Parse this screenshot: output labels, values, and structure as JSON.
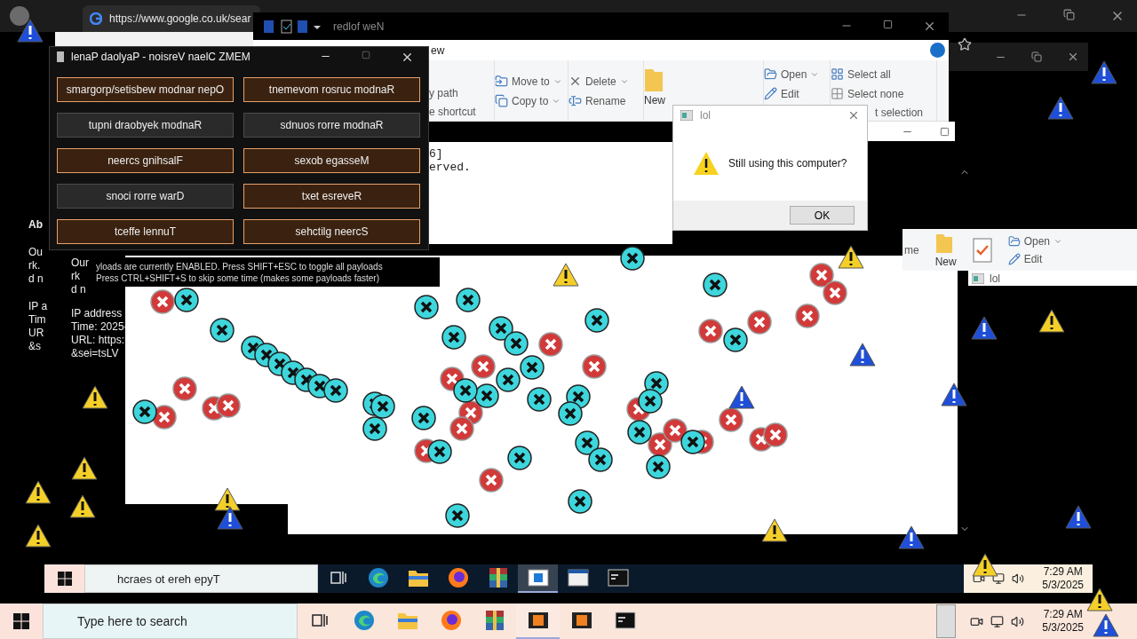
{
  "browser": {
    "tab_title": "https://www.google.co.uk/sear"
  },
  "explorer": {
    "title": "redlof weN",
    "menu_tab": "ew",
    "ribbon_groups": [
      [
        {
          "label": "y path",
          "kind": "text"
        },
        {
          "label": "e shortcut",
          "kind": "text"
        }
      ],
      [
        {
          "label": "Move to",
          "kind": "move"
        },
        {
          "label": "Copy to",
          "kind": "copy"
        }
      ],
      [
        {
          "label": "Delete",
          "kind": "delete"
        },
        {
          "label": "Rename",
          "kind": "rename"
        }
      ],
      [
        {
          "label": "New",
          "kind": "newfolder"
        }
      ],
      [
        {
          "label": "Open",
          "kind": "open"
        },
        {
          "label": "Edit",
          "kind": "edit"
        }
      ],
      [
        {
          "label": "Select all",
          "kind": "selectall"
        },
        {
          "label": "Select none",
          "kind": "selectnone"
        },
        {
          "label": "t selection",
          "kind": "text"
        }
      ]
    ]
  },
  "memz": {
    "title": "lenaP daolyaP - noisreV naelC ZMEM",
    "buttons": [
      {
        "label": "smargorp/setisbew modnar nepO",
        "on": true
      },
      {
        "label": "tnemevom rosruc modnaR",
        "on": true
      },
      {
        "label": "tupni draobyek modnaR",
        "on": false
      },
      {
        "label": "sdnuos rorre modnaR",
        "on": false
      },
      {
        "label": "neercs gnihsalF",
        "on": true
      },
      {
        "label": "sexob egasseM",
        "on": true
      },
      {
        "label": "snoci rorre warD",
        "on": false
      },
      {
        "label": "txet esreveR",
        "on": true
      },
      {
        "label": "tceffe lennuT",
        "on": true
      },
      {
        "label": "sehctilg neercS",
        "on": true
      }
    ],
    "status_lines": [
      "yloads are currently ENABLED. Press SHIFT+ESC to toggle all payloads",
      "Press CTRL+SHIFT+S to skip some time (makes some payloads faster)"
    ]
  },
  "console": {
    "lines": [
      "6]",
      "erved."
    ]
  },
  "dialog": {
    "title": "lol",
    "message": "Still using this computer?",
    "button": "OK"
  },
  "page_fragments": {
    "column_1": [
      [
        "Ab"
      ],
      [
        "Ou",
        "rk.",
        "d n"
      ],
      [
        "IP a",
        "Tim",
        "UR",
        "&s"
      ]
    ],
    "column_2": [
      [
        "Our",
        "rk",
        "d n"
      ],
      [
        "IP address",
        "Time: 2025-",
        "URL: https:",
        "&sei=tsLV"
      ]
    ]
  },
  "side_explorer": {
    "partial_label": "me",
    "new_label": "New",
    "open": "Open",
    "edit": "Edit",
    "dialog_title": "lol"
  },
  "inner_taskbar": {
    "search": "hcraes ot ereh epyT",
    "time": "7:29 AM",
    "date": "5/3/2025",
    "apps": [
      {
        "kind": "edge",
        "selected": false
      },
      {
        "kind": "folder",
        "selected": false
      },
      {
        "kind": "firefox",
        "selected": false
      },
      {
        "kind": "archive",
        "selected": false
      },
      {
        "kind": "notepad",
        "selected": true
      },
      {
        "kind": "window",
        "selected": false
      },
      {
        "kind": "terminal",
        "selected": false
      }
    ]
  },
  "taskbar": {
    "search_placeholder": "Type here to search",
    "time": "7:29 AM",
    "date": "5/3/2025",
    "apps": [
      {
        "kind": "edge",
        "selected": false
      },
      {
        "kind": "folder",
        "selected": false
      },
      {
        "kind": "firefox",
        "selected": false
      },
      {
        "kind": "archive",
        "selected": false
      },
      {
        "kind": "slides",
        "selected": true
      },
      {
        "kind": "slides",
        "selected": false
      },
      {
        "kind": "terminal",
        "selected": false
      }
    ]
  }
}
